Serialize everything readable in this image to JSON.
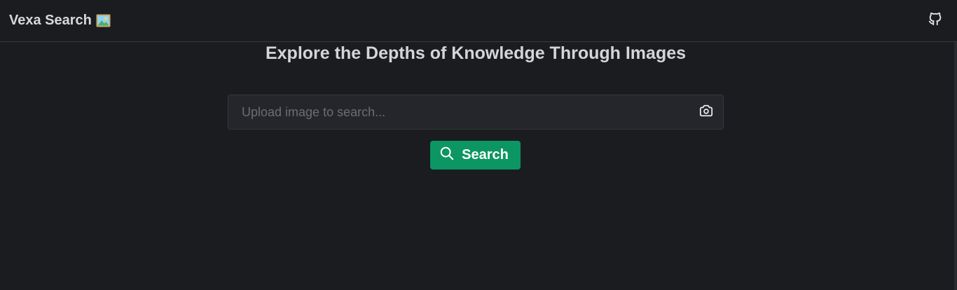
{
  "header": {
    "brand_text": "Vexa Search",
    "brand_icon": "framed-picture-icon",
    "github_icon": "github-icon"
  },
  "main": {
    "headline": "Explore the Depths of Knowledge Through Images",
    "search": {
      "placeholder": "Upload image to search...",
      "value": "",
      "camera_icon": "camera-icon"
    },
    "search_button": {
      "label": "Search",
      "icon": "search-icon"
    }
  },
  "colors": {
    "background": "#1b1c20",
    "accent": "#0c9663",
    "text": "#d4d5d9"
  }
}
